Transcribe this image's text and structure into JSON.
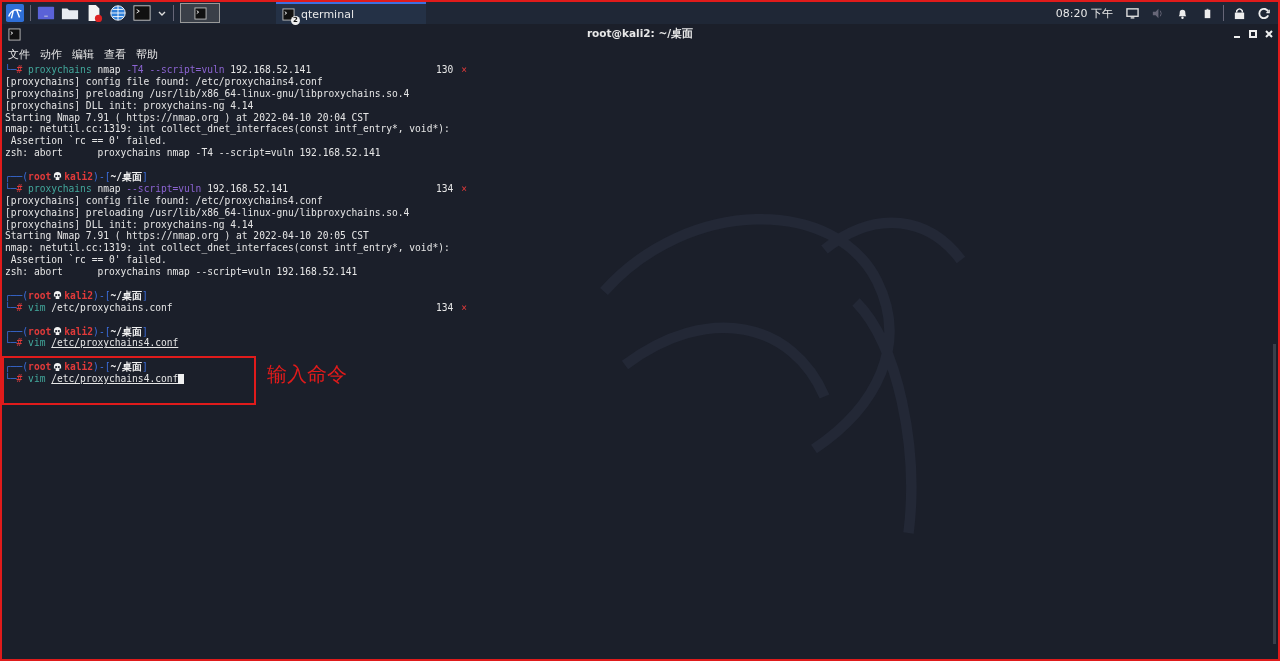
{
  "taskbar": {
    "launchers": [
      {
        "kind": "kali"
      },
      {
        "kind": "desktop"
      },
      {
        "kind": "folder"
      },
      {
        "kind": "document"
      },
      {
        "kind": "globe"
      },
      {
        "kind": "terminal"
      },
      {
        "kind": "caret"
      }
    ],
    "tasks": [
      {
        "kind": "window",
        "selected": true
      },
      {
        "kind": "app",
        "label": "qterminal",
        "badge": "2",
        "selected": true
      }
    ],
    "clock": "08:20 下午"
  },
  "window": {
    "title": "root@kali2: ~/桌面"
  },
  "menu": [
    "文件",
    "动作",
    "编辑",
    "查看",
    "帮助"
  ],
  "lines": [
    {
      "kind": "command",
      "parts": [
        {
          "kind": "frame",
          "text": "└─"
        },
        {
          "kind": "hash",
          "text": "#"
        },
        {
          "kind": "cmd",
          "text": " proxychains"
        },
        {
          "kind": "plain",
          "text": " nmap "
        },
        {
          "kind": "arg",
          "text": "-T4 --script=vuln"
        },
        {
          "kind": "plain",
          "text": " 192.168.52.141"
        }
      ],
      "exit_code": "130",
      "error_mark": "×",
      "cursor": false
    },
    {
      "kind": "output",
      "text": "[proxychains] config file found: /etc/proxychains4.conf"
    },
    {
      "kind": "output",
      "text": "[proxychains] preloading /usr/lib/x86_64-linux-gnu/libproxychains.so.4"
    },
    {
      "kind": "output",
      "text": "[proxychains] DLL init: proxychains-ng 4.14"
    },
    {
      "kind": "output",
      "text": "Starting Nmap 7.91 ( https://nmap.org ) at 2022-04-10 20:04 CST"
    },
    {
      "kind": "output",
      "text": "nmap: netutil.cc:1319: int collect_dnet_interfaces(const intf_entry*, void*):"
    },
    {
      "kind": "output",
      "text": " Assertion `rc == 0' failed."
    },
    {
      "kind": "output",
      "text": "zsh: abort      proxychains nmap -T4 --script=vuln 192.168.52.141"
    },
    {
      "kind": "prompt",
      "parts": [
        {
          "kind": "frame",
          "text": "┌──("
        },
        {
          "kind": "user",
          "text": "root"
        },
        {
          "kind": "skull"
        },
        {
          "kind": "user",
          "text": "kali2"
        },
        {
          "kind": "frame",
          "text": ")-["
        },
        {
          "kind": "path",
          "text": "~/桌面"
        },
        {
          "kind": "frame",
          "text": "]"
        }
      ]
    },
    {
      "kind": "command",
      "parts": [
        {
          "kind": "frame",
          "text": "└─"
        },
        {
          "kind": "hash",
          "text": "#"
        },
        {
          "kind": "cmd",
          "text": " proxychains"
        },
        {
          "kind": "plain",
          "text": " nmap "
        },
        {
          "kind": "arg",
          "text": "--script=vuln"
        },
        {
          "kind": "plain",
          "text": " 192.168.52.141"
        }
      ],
      "exit_code": "134",
      "error_mark": "×",
      "cursor": false
    },
    {
      "kind": "output",
      "text": "[proxychains] config file found: /etc/proxychains4.conf"
    },
    {
      "kind": "output",
      "text": "[proxychains] preloading /usr/lib/x86_64-linux-gnu/libproxychains.so.4"
    },
    {
      "kind": "output",
      "text": "[proxychains] DLL init: proxychains-ng 4.14"
    },
    {
      "kind": "output",
      "text": "Starting Nmap 7.91 ( https://nmap.org ) at 2022-04-10 20:05 CST"
    },
    {
      "kind": "output",
      "text": "nmap: netutil.cc:1319: int collect_dnet_interfaces(const intf_entry*, void*):"
    },
    {
      "kind": "output",
      "text": " Assertion `rc == 0' failed."
    },
    {
      "kind": "output",
      "text": "zsh: abort      proxychains nmap --script=vuln 192.168.52.141"
    },
    {
      "kind": "prompt",
      "parts": [
        {
          "kind": "frame",
          "text": "┌──("
        },
        {
          "kind": "user",
          "text": "root"
        },
        {
          "kind": "skull"
        },
        {
          "kind": "user",
          "text": "kali2"
        },
        {
          "kind": "frame",
          "text": ")-["
        },
        {
          "kind": "path",
          "text": "~/桌面"
        },
        {
          "kind": "frame",
          "text": "]"
        }
      ]
    },
    {
      "kind": "command",
      "parts": [
        {
          "kind": "frame",
          "text": "└─"
        },
        {
          "kind": "hash",
          "text": "#"
        },
        {
          "kind": "cmd2",
          "text": " vim"
        },
        {
          "kind": "plain",
          "text": " /etc/proxychains.conf"
        }
      ],
      "exit_code": "134",
      "error_mark": "×",
      "cursor": false
    },
    {
      "kind": "prompt",
      "parts": [
        {
          "kind": "frame",
          "text": "┌──("
        },
        {
          "kind": "user",
          "text": "root"
        },
        {
          "kind": "skull"
        },
        {
          "kind": "user",
          "text": "kali2"
        },
        {
          "kind": "frame",
          "text": ")-["
        },
        {
          "kind": "path",
          "text": "~/桌面"
        },
        {
          "kind": "frame",
          "text": "]"
        }
      ]
    },
    {
      "kind": "command",
      "parts": [
        {
          "kind": "frame",
          "text": "└─"
        },
        {
          "kind": "hash",
          "text": "#"
        },
        {
          "kind": "cmd2",
          "text": " vim "
        },
        {
          "kind": "file",
          "text": "/etc/proxychains4.conf"
        }
      ],
      "cursor": false
    },
    {
      "kind": "prompt",
      "parts": [
        {
          "kind": "frame",
          "text": "┌──("
        },
        {
          "kind": "user",
          "text": "root"
        },
        {
          "kind": "skull"
        },
        {
          "kind": "user",
          "text": "kali2"
        },
        {
          "kind": "frame",
          "text": ")-["
        },
        {
          "kind": "path",
          "text": "~/桌面"
        },
        {
          "kind": "frame",
          "text": "]"
        }
      ]
    },
    {
      "kind": "command",
      "parts": [
        {
          "kind": "frame",
          "text": "└─"
        },
        {
          "kind": "hash",
          "text": "#"
        },
        {
          "kind": "cmd2",
          "text": " vim "
        },
        {
          "kind": "file",
          "text": "/etc/proxychains4.conf"
        }
      ],
      "cursor": true
    }
  ],
  "annotation": {
    "text": "输入命令"
  }
}
